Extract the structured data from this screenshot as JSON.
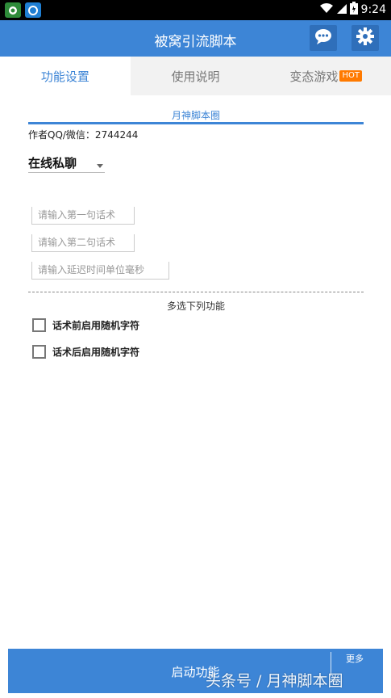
{
  "status_bar": {
    "time": "9:24",
    "icons": [
      "app-icon-green",
      "app-icon-blue",
      "wifi-icon",
      "signal-icon",
      "battery-icon"
    ]
  },
  "app_bar": {
    "title": "被窝引流脚本",
    "icons": [
      "chat-icon",
      "gear-icon"
    ]
  },
  "tabs": [
    {
      "label": "功能设置",
      "active": true
    },
    {
      "label": "使用说明",
      "active": false
    },
    {
      "label": "变态游戏",
      "badge": "HOT",
      "active": false
    }
  ],
  "section": {
    "title": "月神脚本圈",
    "author": "作者QQ/微信：2744244"
  },
  "spinner": {
    "value": "在线私聊"
  },
  "inputs": [
    {
      "placeholder": "请输入第一句话术"
    },
    {
      "placeholder": "请输入第二句话术"
    },
    {
      "placeholder": "请输入延迟时间单位毫秒"
    }
  ],
  "multi_select": {
    "title": "多选下列功能",
    "options": [
      {
        "label": "话术前启用随机字符",
        "checked": false
      },
      {
        "label": "话术后启用随机字符",
        "checked": false
      }
    ]
  },
  "bottom_bar": {
    "start_label": "启动功能",
    "more_label": "更多"
  },
  "watermark": "头条号 / 月神脚本圈",
  "colors": {
    "accent": "#3d85d6",
    "hot": "#ff7a00"
  }
}
